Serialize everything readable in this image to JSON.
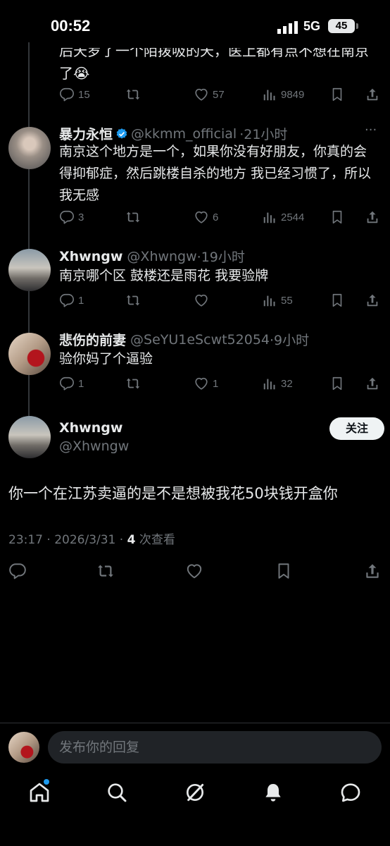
{
  "status_bar": {
    "time": "00:52",
    "network": "5G",
    "battery": "45"
  },
  "partial_tweet": {
    "text_line1": "后天罗了一个陌拨吸的天，医上都有点不想在南京",
    "text_line2": "了😭",
    "actions": {
      "replies": "15",
      "likes": "57",
      "views": "9849"
    }
  },
  "replies": [
    {
      "name": "暴力永恒",
      "verified": true,
      "handle": "@kkmm_official",
      "time": "·21小时",
      "text": "南京这个地方是一个，如果你没有好朋友，你真的会得抑郁症，然后跳楼自杀的地方 我已经习惯了，所以我无感",
      "actions": {
        "replies": "3",
        "reposts": "",
        "likes": "6",
        "views": "2544"
      }
    },
    {
      "name": "Xhwngw",
      "verified": false,
      "handle": "@Xhwngw",
      "time": "·19小时",
      "text": "南京哪个区 鼓楼还是雨花 我要验牌",
      "actions": {
        "replies": "1",
        "reposts": "",
        "likes": "",
        "views": "55"
      }
    },
    {
      "name": "悲伤的前妻",
      "verified": false,
      "handle": "@SeYU1eScwt52054",
      "time": "·9小时",
      "text": "验你妈了个逼验",
      "actions": {
        "replies": "1",
        "reposts": "",
        "likes": "1",
        "views": "32"
      }
    }
  ],
  "main_tweet": {
    "name": "Xhwngw",
    "handle": "@Xhwngw",
    "follow_label": "关注",
    "text": "你一个在江苏卖逼的是不是想被我花50块钱开盒你",
    "timestamp": "23:17 · 2026/3/31 · ",
    "views_count": "4",
    "views_label": " 次查看"
  },
  "reply_input": {
    "placeholder": "发布你的回复"
  },
  "bottom_nav": [
    "home-icon",
    "search-icon",
    "grok-icon",
    "notifications-icon",
    "messages-icon"
  ],
  "colors": {
    "background": "#000000",
    "text": "#e7e9ea",
    "muted": "#71767b",
    "verified": "#1d9bf0"
  }
}
